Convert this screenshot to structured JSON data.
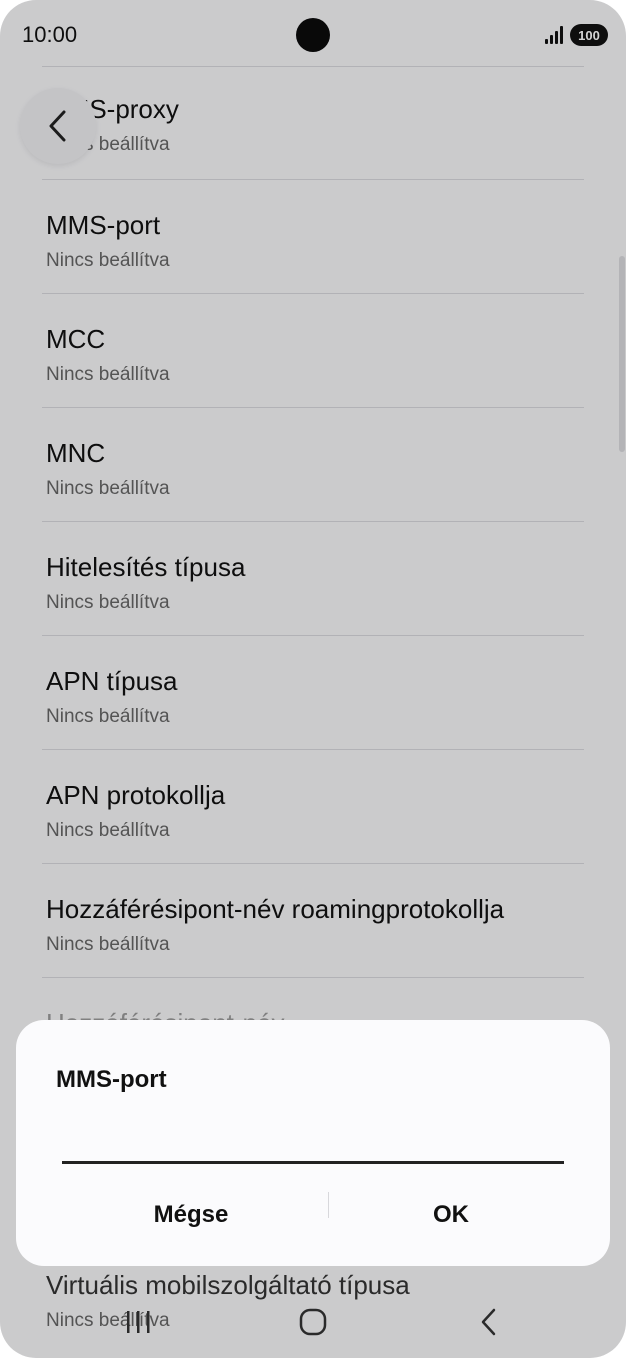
{
  "status_bar": {
    "time": "10:00",
    "battery": "100"
  },
  "list": {
    "items": [
      {
        "title": "MMS-proxy",
        "subtitle": "Nincs beállítva"
      },
      {
        "title": "MMS-port",
        "subtitle": "Nincs beállítva"
      },
      {
        "title": "MCC",
        "subtitle": "Nincs beállítva"
      },
      {
        "title": "MNC",
        "subtitle": "Nincs beállítva"
      },
      {
        "title": "Hitelesítés típusa",
        "subtitle": "Nincs beállítva"
      },
      {
        "title": "APN típusa",
        "subtitle": "Nincs beállítva"
      },
      {
        "title": "APN protokollja",
        "subtitle": "Nincs beállítva"
      },
      {
        "title": "Hozzáférésipont-név roamingprotokollja",
        "subtitle": "Nincs beállítva"
      },
      {
        "title": "Hozzáférésipont-név",
        "subtitle": ""
      }
    ],
    "bottom_item": {
      "title": "Virtuális mobilszolgáltató típusa",
      "subtitle": "Nincs beállítva"
    }
  },
  "dialog": {
    "title": "MMS-port",
    "input_value": "",
    "cancel_label": "Mégse",
    "ok_label": "OK"
  },
  "icons": {
    "back": "chevron-left-icon",
    "nav_recents": "recents-icon",
    "nav_home": "home-icon",
    "nav_back": "back-icon"
  },
  "colors": {
    "background": "#f4f4f6",
    "dialog": "#fbfbfd",
    "text": "#111111",
    "subtext": "#666666"
  }
}
